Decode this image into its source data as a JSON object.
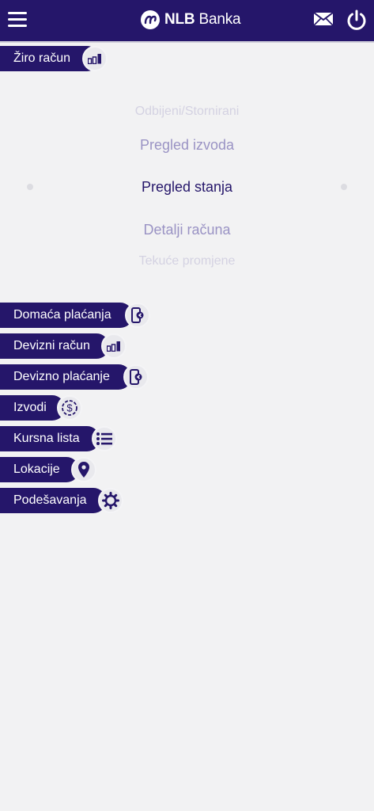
{
  "header": {
    "brand_bold": "NLB",
    "brand_light": "Banka",
    "menu_icon": "hamburger-icon",
    "mail_icon": "mail-icon",
    "power_icon": "power-icon",
    "color": "#25166a"
  },
  "selected_section": {
    "label": "Žiro račun",
    "icon": "bar-chart-icon"
  },
  "picker": {
    "items": [
      "Odbijeni/Stornirani",
      "Pregled izvoda",
      "Pregled stanja",
      "Detalji računa",
      "Tekuće promjene"
    ],
    "selected": "Pregled stanja"
  },
  "menu": [
    {
      "label": "Domaća plaćanja",
      "icon": "mobile-payment-icon"
    },
    {
      "label": "Devizni račun",
      "icon": "bar-chart-icon"
    },
    {
      "label": "Devizno plaćanje",
      "icon": "mobile-payment-icon"
    },
    {
      "label": "Izvodi",
      "icon": "dollar-cycle-icon"
    },
    {
      "label": "Kursna lista",
      "icon": "list-icon"
    },
    {
      "label": "Lokacije",
      "icon": "location-pin-icon"
    },
    {
      "label": "Podešavanja",
      "icon": "gear-icon"
    }
  ]
}
